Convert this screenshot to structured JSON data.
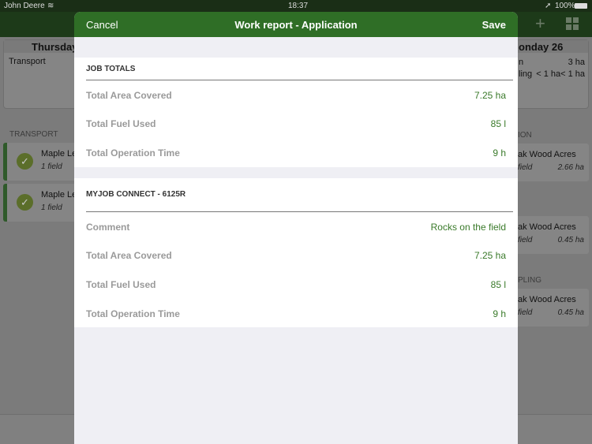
{
  "status_bar": {
    "carrier": "John Deere",
    "time": "18:37",
    "battery": "100%"
  },
  "background": {
    "left_day": "Thursday",
    "left_summary": "Transport",
    "left_section": "TRANSPORT",
    "left_jobs": [
      {
        "title": "Maple Le",
        "subtitle": "1 field"
      },
      {
        "title": "Maple Le",
        "subtitle": "1 field"
      }
    ],
    "right_day": "onday 26",
    "right_summary": [
      {
        "label": "n",
        "value": "3 ha"
      },
      {
        "label": "",
        "value": "< 1 ha"
      },
      {
        "label": "ling",
        "value": "< 1 ha"
      }
    ],
    "right_sections": [
      "ION",
      "PLING"
    ],
    "right_jobs": [
      {
        "title": "ak Wood Acres",
        "subtitle": "field",
        "value": "2.66 ha"
      },
      {
        "title": "ak Wood Acres",
        "subtitle": "field",
        "value": "0.45 ha"
      },
      {
        "title": "ak Wood Acres",
        "subtitle": "field",
        "value": "0.45 ha"
      }
    ]
  },
  "modal": {
    "cancel": "Cancel",
    "title": "Work report - Application",
    "save": "Save",
    "sections": [
      {
        "header": "JOB TOTALS",
        "rows": [
          {
            "label": "Total Area Covered",
            "value": "7.25 ha"
          },
          {
            "label": "Total Fuel Used",
            "value": "85 l"
          },
          {
            "label": "Total Operation Time",
            "value": "9 h"
          }
        ]
      },
      {
        "header": "MYJOB CONNECT - 6125R",
        "rows": [
          {
            "label": "Comment",
            "value": "Rocks on the field"
          },
          {
            "label": "Total Area Covered",
            "value": "7.25 ha"
          },
          {
            "label": "Total Fuel Used",
            "value": "85 l"
          },
          {
            "label": "Total Operation Time",
            "value": "9 h"
          }
        ]
      }
    ]
  }
}
